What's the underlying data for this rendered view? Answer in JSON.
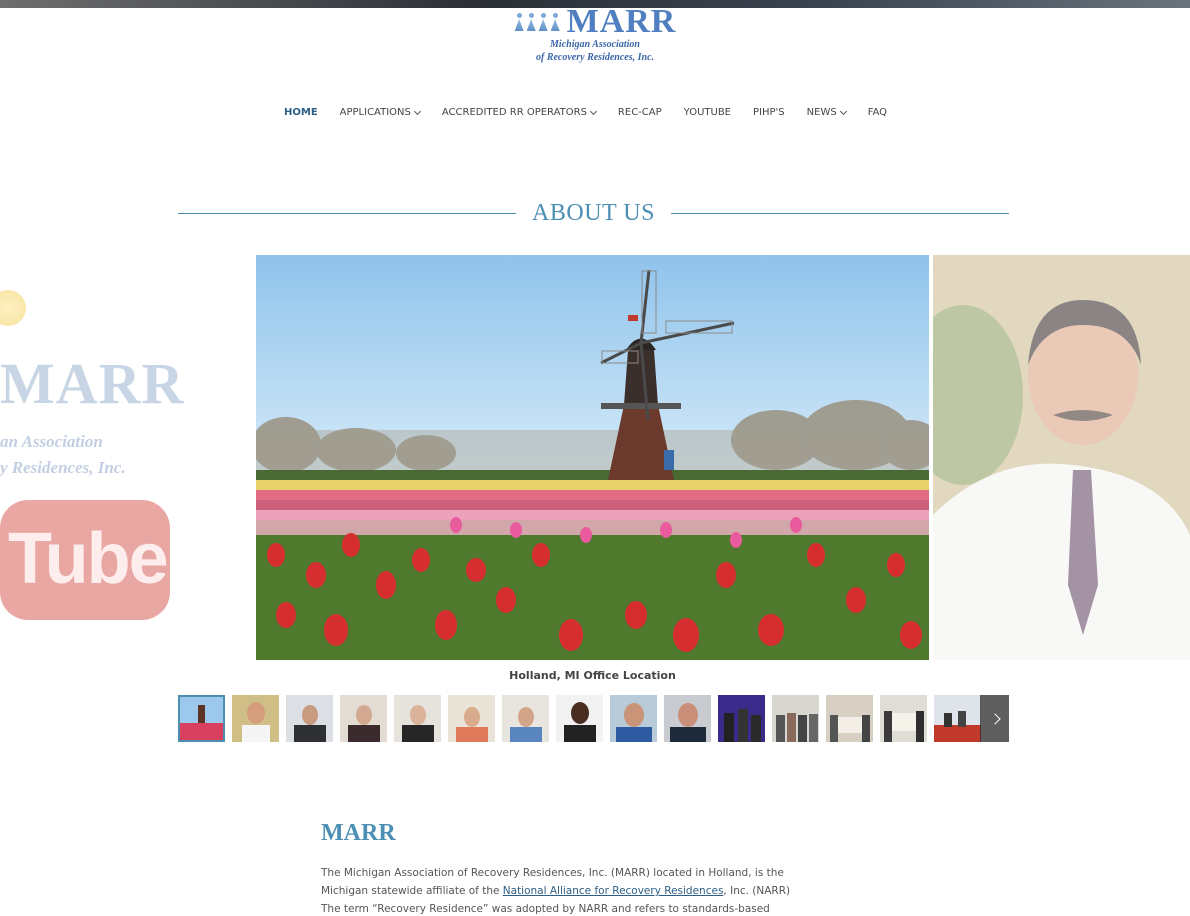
{
  "logo": {
    "word": "MARR",
    "sub_line1": "Michigan Association",
    "sub_line2": "of Recovery Residences, Inc."
  },
  "nav": {
    "items": [
      {
        "label": "HOME",
        "active": true,
        "dropdown": false
      },
      {
        "label": "APPLICATIONS",
        "active": false,
        "dropdown": true
      },
      {
        "label": "ACCREDITED RR OPERATORS",
        "active": false,
        "dropdown": true
      },
      {
        "label": "REC-CAP",
        "active": false,
        "dropdown": false
      },
      {
        "label": "YOUTUBE",
        "active": false,
        "dropdown": false
      },
      {
        "label": "PIHP'S",
        "active": false,
        "dropdown": false
      },
      {
        "label": "NEWS",
        "active": false,
        "dropdown": true
      },
      {
        "label": "FAQ",
        "active": false,
        "dropdown": false
      }
    ]
  },
  "about": {
    "heading": "ABOUT US"
  },
  "ghost": {
    "word": "MARR",
    "sub1": "an Association",
    "sub2": "y Residences, Inc.",
    "tube": "Tube"
  },
  "slider": {
    "caption": "Holland, MI Office Location",
    "thumb_count": 15
  },
  "marr": {
    "title": "MARR",
    "line1": "The Michigan Association of Recovery Residences, Inc. (MARR) located in Holland, is the",
    "line2_pre": "Michigan statewide affiliate of the ",
    "line2_link": "National Alliance for Recovery Residences",
    "line2_post": ", Inc. (NARR)",
    "line3": "The term “Recovery Residence” was adopted by NARR and refers to standards-based"
  },
  "colors": {
    "accent": "#4c8fb4",
    "nav_active": "#2c5e86"
  }
}
